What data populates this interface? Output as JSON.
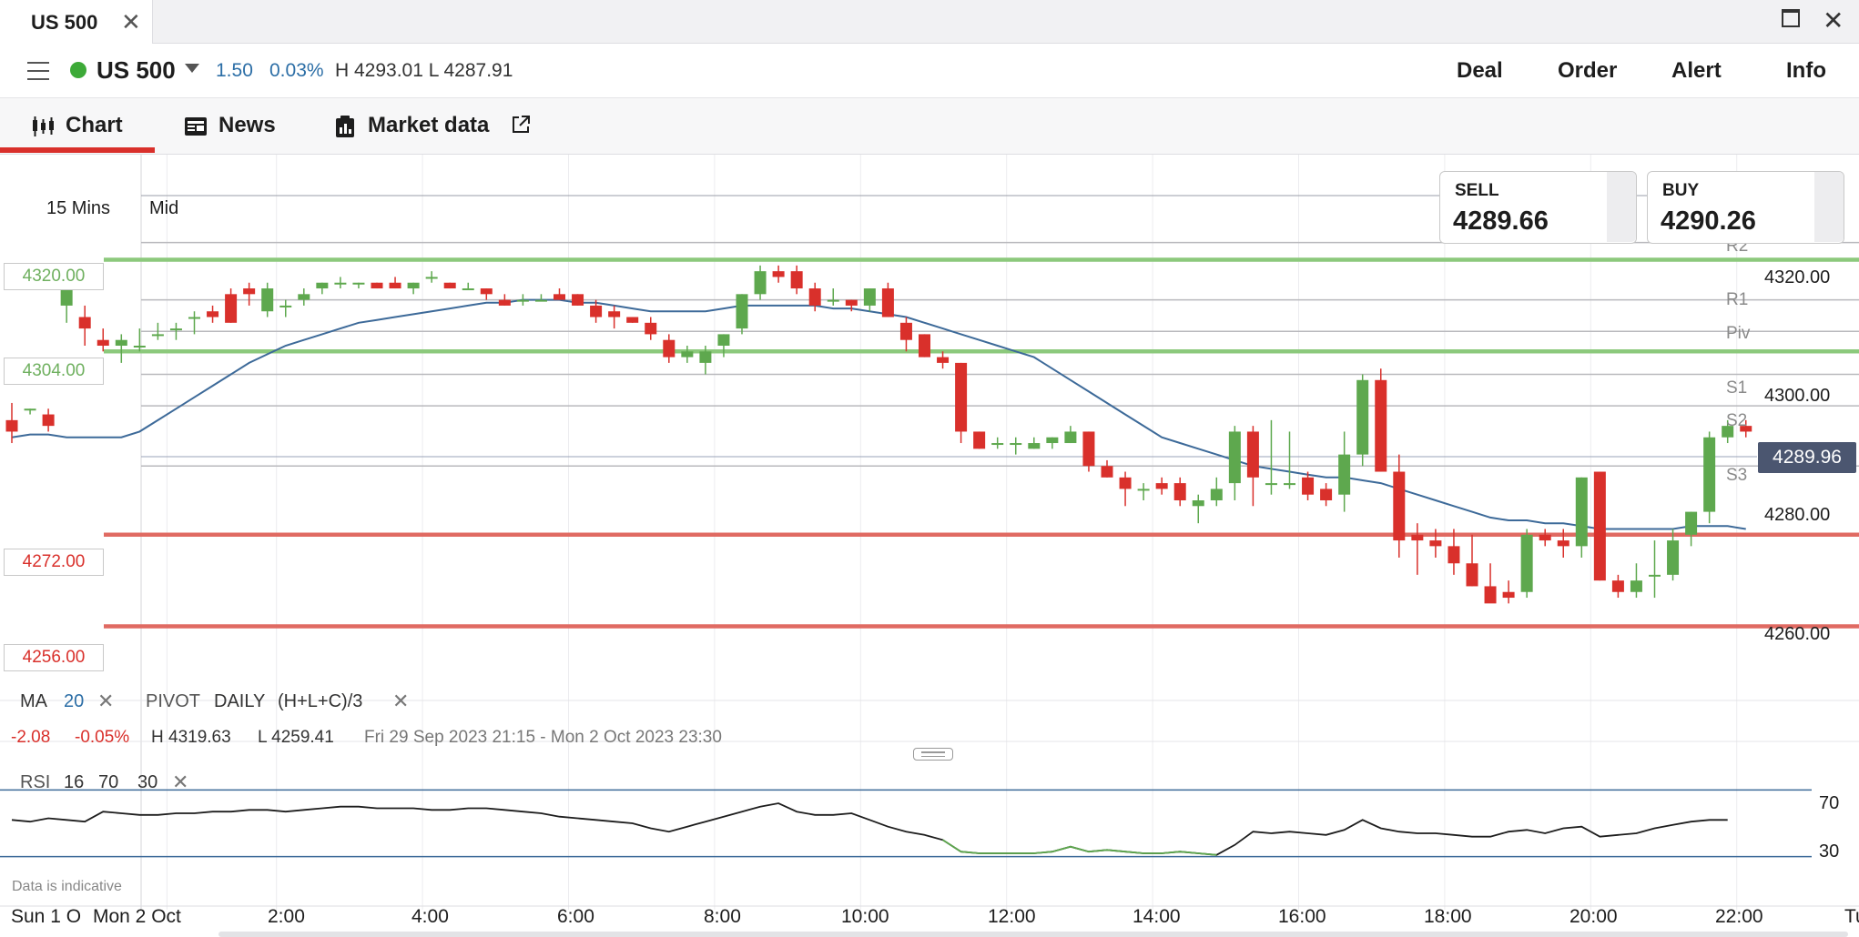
{
  "window": {
    "tab_title": "US 500",
    "close_glyph": "✕"
  },
  "header": {
    "instrument": "US 500",
    "change_abs": "1.50",
    "change_pct": "0.03%",
    "high_low": "H 4293.01  L 4287.91",
    "actions": [
      "Deal",
      "Order",
      "Alert",
      "Info"
    ]
  },
  "tabs": {
    "chart": "Chart",
    "news": "News",
    "market_data": "Market data"
  },
  "toolbar": {
    "timeframe": "15 Mins",
    "price_type": "Mid"
  },
  "tickets": {
    "sell_label": "SELL",
    "sell_price": "4289.66",
    "buy_label": "BUY",
    "buy_price": "4290.26"
  },
  "levels": [
    {
      "label": "4320.00",
      "value": 4320,
      "color": "#8cc97c"
    },
    {
      "label": "4304.00",
      "value": 4304,
      "color": "#8cc97c"
    },
    {
      "label": "4272.00",
      "value": 4272,
      "color": "#e06a62"
    },
    {
      "label": "4256.00",
      "value": 4256,
      "color": "#e06a62"
    }
  ],
  "pivots": [
    {
      "label": "R2",
      "value": 4323
    },
    {
      "label": "R1",
      "value": 4313
    },
    {
      "label": "Piv",
      "value": 4307.5
    },
    {
      "label": "S1",
      "value": 4300
    },
    {
      "label": "S2",
      "value": 4294.5
    },
    {
      "label": "S3",
      "value": 4284
    }
  ],
  "last_price": "4289.96",
  "indicators": {
    "ma_label": "MA",
    "ma_period": "20",
    "pivot_label": "PIVOT",
    "pivot_freq": "DAILY",
    "pivot_formula": "(H+L+C)/3",
    "period_change_abs": "-2.08",
    "period_change_pct": "-0.05%",
    "period_high": "H 4319.63",
    "period_low": "L 4259.41",
    "range_text": "Fri 29 Sep 2023 21:15 - Mon 2 Oct 2023 23:30",
    "rsi_label": "RSI",
    "rsi_period": "16",
    "rsi_upper": "70",
    "rsi_lower": "30",
    "remove_glyph": "✕"
  },
  "footer": {
    "disclaimer": "Data is indicative"
  },
  "colors": {
    "up": "#5ea84e",
    "down": "#d9302b",
    "ma": "#3d6a99",
    "accent": "#d9302b",
    "rsi_band": "#3d6a99"
  },
  "chart_data": {
    "type": "candlestick",
    "title": "",
    "y_ticks": [
      "4320.00",
      "4300.00",
      "4280.00",
      "4260.00"
    ],
    "ylim": [
      4251,
      4332
    ],
    "x_ticks": [
      "Sun 1 O",
      "Mon 2 Oct",
      "2:00",
      "4:00",
      "6:00",
      "8:00",
      "10:00",
      "12:00",
      "14:00",
      "16:00",
      "18:00",
      "20:00",
      "22:00",
      "Tu"
    ],
    "x_tick_slots": [
      -3,
      8,
      14,
      22,
      30,
      38,
      46,
      54,
      62,
      70,
      78,
      86,
      94,
      101
    ],
    "ohlc": [
      [
        4292,
        4295,
        4288,
        4290
      ],
      [
        4294,
        4294,
        4293,
        4294
      ],
      [
        4293,
        4294,
        4290,
        4291
      ],
      [
        4312,
        4317,
        4309,
        4318
      ],
      [
        4310,
        4312,
        4305,
        4308
      ],
      [
        4306,
        4308,
        4304,
        4305
      ],
      [
        4305,
        4307,
        4302,
        4306
      ],
      [
        4305,
        4308,
        4304,
        4305
      ],
      [
        4307,
        4309,
        4306,
        4307
      ],
      [
        4308,
        4309,
        4306,
        4308
      ],
      [
        4310,
        4311,
        4307,
        4310
      ],
      [
        4311,
        4312,
        4309,
        4310
      ],
      [
        4314,
        4315,
        4309,
        4309
      ],
      [
        4315,
        4316,
        4312,
        4314
      ],
      [
        4311,
        4316,
        4310,
        4315
      ],
      [
        4312,
        4313,
        4310,
        4312
      ],
      [
        4313,
        4315,
        4312,
        4314
      ],
      [
        4315,
        4316,
        4314,
        4316
      ],
      [
        4316,
        4317,
        4315,
        4316
      ],
      [
        4316,
        4316,
        4315,
        4316
      ],
      [
        4316,
        4316,
        4315,
        4315
      ],
      [
        4316,
        4317,
        4315,
        4315
      ],
      [
        4315,
        4316,
        4314,
        4316
      ],
      [
        4317,
        4318,
        4316,
        4317
      ],
      [
        4316,
        4316,
        4315,
        4315
      ],
      [
        4315,
        4316,
        4315,
        4315
      ],
      [
        4315,
        4315,
        4313,
        4314
      ],
      [
        4313,
        4314,
        4312,
        4312
      ],
      [
        4313,
        4314,
        4312,
        4313
      ],
      [
        4313,
        4314,
        4313,
        4313
      ],
      [
        4314,
        4315,
        4313,
        4313
      ],
      [
        4314,
        4314,
        4312,
        4312
      ],
      [
        4312,
        4313,
        4309,
        4310
      ],
      [
        4311,
        4312,
        4308,
        4310
      ],
      [
        4310,
        4310,
        4309,
        4309
      ],
      [
        4309,
        4310,
        4306,
        4307
      ],
      [
        4306,
        4307,
        4302,
        4303
      ],
      [
        4303,
        4305,
        4302,
        4304
      ],
      [
        4302,
        4305,
        4300,
        4304
      ],
      [
        4305,
        4307,
        4303,
        4307
      ],
      [
        4308,
        4314,
        4307,
        4314
      ],
      [
        4314,
        4319,
        4313,
        4318
      ],
      [
        4318,
        4319,
        4316,
        4317
      ],
      [
        4318,
        4319,
        4314,
        4315
      ],
      [
        4315,
        4316,
        4311,
        4312
      ],
      [
        4313,
        4315,
        4312,
        4313
      ],
      [
        4313,
        4313,
        4311,
        4312
      ],
      [
        4312,
        4315,
        4311,
        4315
      ],
      [
        4315,
        4316,
        4310,
        4310
      ],
      [
        4309,
        4310,
        4304,
        4306
      ],
      [
        4307,
        4307,
        4303,
        4303
      ],
      [
        4303,
        4304,
        4301,
        4302
      ],
      [
        4302,
        4302,
        4288,
        4290
      ],
      [
        4290,
        4290,
        4287,
        4287
      ],
      [
        4288,
        4289,
        4287,
        4288
      ],
      [
        4288,
        4289,
        4286,
        4288
      ],
      [
        4287,
        4289,
        4287,
        4288
      ],
      [
        4288,
        4289,
        4287,
        4289
      ],
      [
        4288,
        4291,
        4288,
        4290
      ],
      [
        4290,
        4290,
        4283,
        4284
      ],
      [
        4284,
        4285,
        4282,
        4282
      ],
      [
        4282,
        4283,
        4277,
        4280
      ],
      [
        4280,
        4281,
        4278,
        4280
      ],
      [
        4281,
        4282,
        4279,
        4280
      ],
      [
        4281,
        4282,
        4277,
        4278
      ],
      [
        4277,
        4279,
        4274,
        4278
      ],
      [
        4278,
        4282,
        4277,
        4280
      ],
      [
        4281,
        4291,
        4278,
        4290
      ],
      [
        4290,
        4291,
        4277,
        4282
      ],
      [
        4281,
        4292,
        4279,
        4281
      ],
      [
        4281,
        4290,
        4280,
        4281
      ],
      [
        4282,
        4283,
        4278,
        4279
      ],
      [
        4280,
        4281,
        4277,
        4278
      ],
      [
        4279,
        4290,
        4276,
        4286
      ],
      [
        4286,
        4300,
        4284,
        4299
      ],
      [
        4299,
        4301,
        4283,
        4283
      ],
      [
        4283,
        4286,
        4268,
        4271
      ],
      [
        4272,
        4274,
        4265,
        4271
      ],
      [
        4271,
        4273,
        4268,
        4270
      ],
      [
        4270,
        4273,
        4265,
        4267
      ],
      [
        4267,
        4272,
        4263,
        4263
      ],
      [
        4263,
        4267,
        4261,
        4260
      ],
      [
        4262,
        4264,
        4260,
        4261
      ],
      [
        4262,
        4273,
        4261,
        4272
      ],
      [
        4272,
        4273,
        4270,
        4271
      ],
      [
        4271,
        4273,
        4268,
        4270
      ],
      [
        4270,
        4282,
        4268,
        4282
      ],
      [
        4283,
        4283,
        4264,
        4264
      ],
      [
        4264,
        4265,
        4261,
        4262
      ],
      [
        4262,
        4267,
        4261,
        4264
      ],
      [
        4265,
        4271,
        4261,
        4265
      ],
      [
        4265,
        4273,
        4264,
        4271
      ],
      [
        4272,
        4276,
        4270,
        4276
      ],
      [
        4276,
        4290,
        4274,
        4289
      ],
      [
        4289,
        4292,
        4288,
        4291
      ],
      [
        4291,
        4292,
        4289,
        4290
      ]
    ],
    "ma20": [
      4289,
      4289.5,
      4289.5,
      4289,
      4289,
      4289,
      4289,
      4290,
      4292,
      4294,
      4296,
      4298,
      4300,
      4302,
      4303.5,
      4305,
      4306,
      4307,
      4308,
      4309,
      4309.5,
      4310,
      4310.5,
      4311,
      4311.5,
      4312,
      4312.5,
      4312.5,
      4313,
      4313,
      4313,
      4312.5,
      4312.5,
      4312,
      4311.5,
      4311,
      4311,
      4311,
      4311,
      4311.5,
      4312,
      4312,
      4312,
      4312,
      4312,
      4311.5,
      4311.5,
      4311,
      4310.5,
      4310,
      4309,
      4308,
      4307,
      4306,
      4305,
      4304,
      4303,
      4301,
      4299,
      4297,
      4295,
      4293,
      4291,
      4289,
      4288,
      4287,
      4286,
      4285,
      4284,
      4283.5,
      4283,
      4282.5,
      4282,
      4282,
      4281.5,
      4281,
      4280,
      4279,
      4278,
      4277,
      4276,
      4275,
      4274.5,
      4274.5,
      4274,
      4274,
      4273.5,
      4273,
      4273,
      4273,
      4273,
      4273,
      4273.5,
      4273.5,
      4273.5,
      4273
    ],
    "rsi": [
      52,
      51,
      53,
      52,
      51,
      57,
      56,
      55,
      55,
      56,
      56,
      57,
      57,
      58,
      58,
      57,
      58,
      59,
      60,
      60,
      59,
      59,
      59,
      58,
      58,
      59,
      59,
      58,
      57,
      56,
      54,
      53,
      52,
      51,
      50,
      47,
      45,
      48,
      51,
      54,
      57,
      60,
      62,
      57,
      55,
      55,
      56,
      52,
      48,
      45,
      43,
      40,
      33,
      32,
      32,
      32,
      32,
      33,
      36,
      33,
      34,
      33,
      32,
      32,
      33,
      32,
      31,
      37,
      45,
      44,
      45,
      44,
      43,
      46,
      52,
      47,
      45,
      44,
      44,
      43,
      42,
      42,
      45,
      46,
      44,
      47,
      48,
      42,
      43,
      44,
      47,
      49,
      51,
      52,
      52
    ],
    "rsi_ylim": [
      20,
      80
    ],
    "rsi_bands": [
      70,
      30
    ]
  }
}
